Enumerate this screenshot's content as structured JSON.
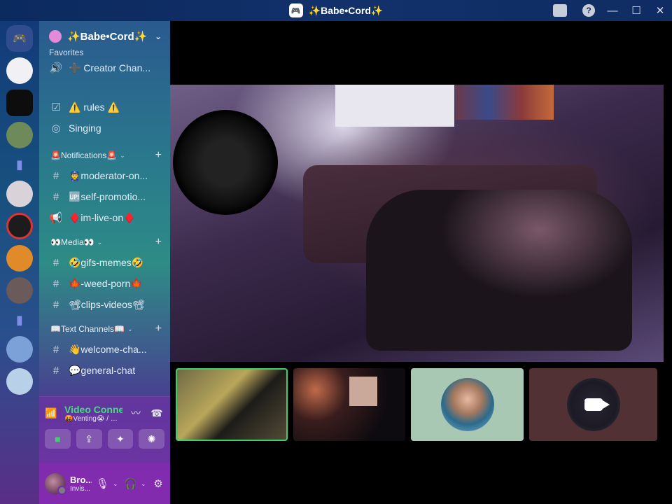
{
  "window": {
    "title": "✨Babe•Cord✨",
    "logo_glyph": "🎮"
  },
  "server_header": {
    "name": "✨Babe•Cord✨",
    "chevron": "⌄"
  },
  "sidebar": {
    "favorites_label": "Favorites",
    "favorites": [
      {
        "icon": "speaker-icon",
        "glyph": "🔊",
        "label": "➕ Creator Chan..."
      }
    ],
    "channels": [
      {
        "icon": "rules-icon",
        "glyph": "☑",
        "label": "⚠️ rules ⚠️"
      },
      {
        "icon": "stage-icon",
        "glyph": "◎",
        "label": "Singing"
      }
    ],
    "categories": [
      {
        "label": "🚨Notifications🚨",
        "channels": [
          {
            "icon": "hash-icon",
            "glyph": "#",
            "label": "👮moderator-on..."
          },
          {
            "icon": "hash-icon",
            "glyph": "#",
            "label": "🆙self-promotio..."
          },
          {
            "icon": "announcement-icon",
            "glyph": "📢",
            "label": "♦️im-live-on♦️"
          }
        ]
      },
      {
        "label": "👀Media👀",
        "channels": [
          {
            "icon": "hash-icon",
            "glyph": "#",
            "label": "🤣gifs-memes🤣"
          },
          {
            "icon": "hash-icon",
            "glyph": "#",
            "label": "🍁-weed-porn🍁"
          },
          {
            "icon": "hash-icon",
            "glyph": "#",
            "label": "📽clips-videos📽"
          }
        ]
      },
      {
        "label": "📖Text Channels📖",
        "channels": [
          {
            "icon": "hash-icon",
            "glyph": "#",
            "label": "👋welcome-cha..."
          },
          {
            "icon": "hash-icon",
            "glyph": "#",
            "label": "💬general-chat"
          }
        ]
      }
    ]
  },
  "voice": {
    "title": "Video Connectec",
    "subtitle": "🤬Venting😭 / ✨...",
    "buttons": [
      "camera-button",
      "screenshare-button",
      "activities-button",
      "soundboard-button"
    ]
  },
  "user": {
    "name": "Bro...",
    "status": "Invis..."
  },
  "colors": {
    "connected_green": "#3ecf6a",
    "titlebar_blue": "#0b2a5e"
  }
}
